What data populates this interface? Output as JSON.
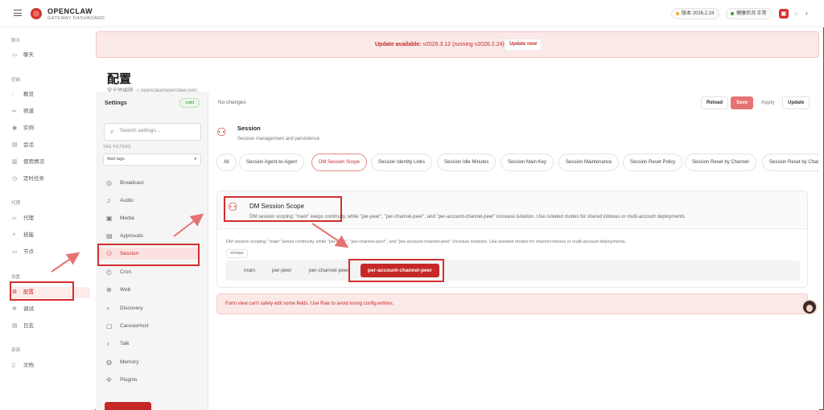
{
  "app": {
    "brand": "OPENCLAW",
    "subtitle": "GATEWAY DASHBOARD",
    "version_label": "版本 2026.2.24",
    "health_label": "健康状况 正常",
    "status_colors": {
      "version": "#f5a623",
      "health": "#3a9a3a",
      "accent": "#c62828"
    }
  },
  "nav": {
    "sections": [
      {
        "label": "聊天",
        "items": [
          {
            "label": "聊天",
            "icon": "chat-icon"
          }
        ]
      },
      {
        "label": "控制",
        "items": [
          {
            "label": "概览",
            "icon": "chart-icon"
          },
          {
            "label": "频道",
            "icon": "link-icon"
          },
          {
            "label": "实例",
            "icon": "radio-icon"
          },
          {
            "label": "会话",
            "icon": "document-icon"
          },
          {
            "label": "使用情况",
            "icon": "bars-icon"
          },
          {
            "label": "定时任务",
            "icon": "clock-icon"
          }
        ]
      },
      {
        "label": "代理",
        "items": [
          {
            "label": "代理",
            "icon": "folder-icon"
          },
          {
            "label": "技能",
            "icon": "bolt-icon"
          },
          {
            "label": "节点",
            "icon": "monitor-icon"
          }
        ]
      },
      {
        "label": "设置",
        "items": [
          {
            "label": "配置",
            "icon": "gear-icon",
            "active": true
          },
          {
            "label": "调试",
            "icon": "bug-icon"
          },
          {
            "label": "日志",
            "icon": "log-icon"
          }
        ]
      },
      {
        "label": "资源",
        "items": [
          {
            "label": "文档",
            "icon": "book-icon"
          }
        ]
      }
    ]
  },
  "banner": {
    "prefix": "Update available:",
    "text": " v2026.3.12 (running v2026.2.24).",
    "button": "Update now"
  },
  "page": {
    "title": "配置",
    "subtitle": "安全地编辑 ~/.openclaw/openclaw.json"
  },
  "settings": {
    "title": "Settings",
    "status": "valid",
    "search_placeholder": "Search settings...",
    "tag_filters_label": "TAG FILTERS",
    "tag_select": "Add tags",
    "items": [
      {
        "label": "Broadcast",
        "icon": "broadcast-icon"
      },
      {
        "label": "Audio",
        "icon": "music-icon"
      },
      {
        "label": "Media",
        "icon": "image-icon"
      },
      {
        "label": "Approvals",
        "icon": "clipboard-icon"
      },
      {
        "label": "Session",
        "icon": "users-icon",
        "active": true
      },
      {
        "label": "Cron",
        "icon": "timer-icon"
      },
      {
        "label": "Web",
        "icon": "globe-icon"
      },
      {
        "label": "Discovery",
        "icon": "search-icon"
      },
      {
        "label": "CanvasHost",
        "icon": "canvas-icon"
      },
      {
        "label": "Talk",
        "icon": "mic-icon"
      },
      {
        "label": "Memory",
        "icon": "database-icon"
      },
      {
        "label": "Plugins",
        "icon": "plugin-icon"
      }
    ]
  },
  "toolbar": {
    "status": "No changes",
    "reload": "Reload",
    "save": "Save",
    "apply": "Apply",
    "update": "Update"
  },
  "section": {
    "title": "Session",
    "description": "Session management and persistence",
    "chips": [
      "All",
      "Session Agent-to-Agent",
      "DM Session Scope",
      "Session Identity Links",
      "Session Idle Minutes",
      "Session Main Key",
      "Session Maintenance",
      "Session Reset Policy",
      "Session Reset by Channel",
      "Session Reset by Chat Type"
    ],
    "active_chip": "DM Session Scope"
  },
  "card": {
    "title": "DM Session Scope",
    "description": "DM session scoping: \"main\" keeps continuity, while \"per-peer\", \"per-channel-peer\", and \"per-account-channel-peer\" increase isolation. Use isolated modes for shared inboxes or multi-account deployments.",
    "body_description": "DM session scoping: \"main\" keeps continuity, while \"per-peer\", \"per-channel-peer\", and \"per-account-channel-peer\" increase isolation. Use isolated modes for shared inboxes or multi-account deployments.",
    "tag": "storage",
    "options": [
      "main",
      "per-peer",
      "per-channel-peer",
      "per-account-channel-peer"
    ],
    "selected": "per-account-channel-peer"
  },
  "warning": "Form view can't safely edit some fields. Use Raw to avoid losing config entries."
}
